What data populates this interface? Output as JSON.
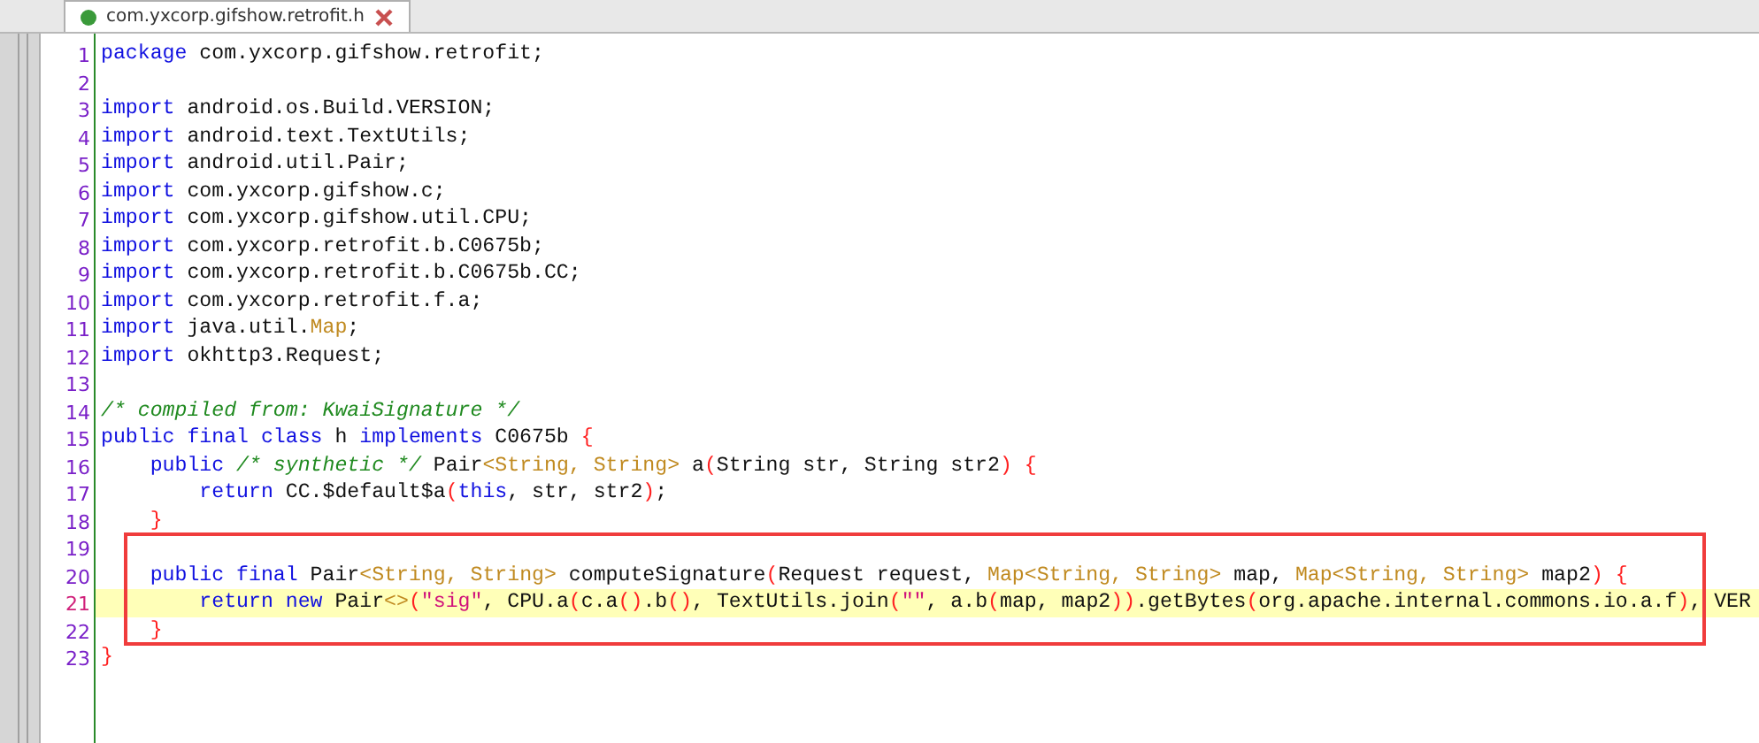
{
  "tab": {
    "title": "com.yxcorp.gifshow.retrofit.h",
    "selected": true
  },
  "lines": [
    {
      "number": "1",
      "current": false,
      "boxed": false,
      "tokens": [
        {
          "kind": "keyword",
          "text": "package"
        },
        {
          "kind": "plain",
          "text": " com.yxcorp.gifshow.retrofit;"
        }
      ]
    },
    {
      "number": "2",
      "current": false,
      "boxed": false
    },
    {
      "number": "3",
      "current": false,
      "boxed": false,
      "tokens": [
        {
          "kind": "keyword",
          "text": "import"
        },
        {
          "kind": "plain",
          "text": " android.os.Build.VERSION;"
        }
      ]
    },
    {
      "number": "4",
      "current": false,
      "boxed": false,
      "tokens": [
        {
          "kind": "keyword",
          "text": "import"
        },
        {
          "kind": "plain",
          "text": " android.text.TextUtils;"
        }
      ]
    },
    {
      "number": "5",
      "current": false,
      "boxed": false,
      "tokens": [
        {
          "kind": "keyword",
          "text": "import"
        },
        {
          "kind": "plain",
          "text": " android.util.Pair;"
        }
      ]
    },
    {
      "number": "6",
      "current": false,
      "boxed": false,
      "tokens": [
        {
          "kind": "keyword",
          "text": "import"
        },
        {
          "kind": "plain",
          "text": " com.yxcorp.gifshow.c;"
        }
      ]
    },
    {
      "number": "7",
      "current": false,
      "boxed": false,
      "tokens": [
        {
          "kind": "keyword",
          "text": "import"
        },
        {
          "kind": "plain",
          "text": " com.yxcorp.gifshow.util.CPU;"
        }
      ]
    },
    {
      "number": "8",
      "current": false,
      "boxed": false,
      "tokens": [
        {
          "kind": "keyword",
          "text": "import"
        },
        {
          "kind": "plain",
          "text": " com.yxcorp.retrofit.b.C0675b;"
        }
      ]
    },
    {
      "number": "9",
      "current": false,
      "boxed": false,
      "tokens": [
        {
          "kind": "keyword",
          "text": "import"
        },
        {
          "kind": "plain",
          "text": " com.yxcorp.retrofit.b.C0675b.CC;"
        }
      ]
    },
    {
      "number": "10",
      "current": false,
      "boxed": false,
      "tokens": [
        {
          "kind": "keyword",
          "text": "import"
        },
        {
          "kind": "plain",
          "text": " com.yxcorp.retrofit.f.a;"
        }
      ]
    },
    {
      "number": "11",
      "current": false,
      "boxed": false,
      "tokens": [
        {
          "kind": "keyword",
          "text": "import"
        },
        {
          "kind": "plain",
          "text": " java.util."
        },
        {
          "kind": "type",
          "text": "Map"
        },
        {
          "kind": "plain",
          "text": ";"
        }
      ]
    },
    {
      "number": "12",
      "current": false,
      "boxed": false,
      "tokens": [
        {
          "kind": "keyword",
          "text": "import"
        },
        {
          "kind": "plain",
          "text": " okhttp3.Request;"
        }
      ]
    },
    {
      "number": "13",
      "current": false,
      "boxed": false
    },
    {
      "number": "14",
      "current": false,
      "boxed": false,
      "tokens": [
        {
          "kind": "comment",
          "text": "/* compiled from: KwaiSignature */"
        }
      ]
    },
    {
      "number": "15",
      "current": false,
      "boxed": false,
      "tokens": [
        {
          "kind": "keyword",
          "text": "public final class"
        },
        {
          "kind": "plain",
          "text": " h "
        },
        {
          "kind": "keyword",
          "text": "implements"
        },
        {
          "kind": "plain",
          "text": " C0675b "
        },
        {
          "kind": "bracket",
          "text": "{"
        }
      ]
    },
    {
      "number": "16",
      "current": false,
      "boxed": false,
      "tokens": [
        {
          "kind": "keyword",
          "text": "    public"
        },
        {
          "kind": "comment",
          "text": " /* synthetic */ "
        },
        {
          "kind": "plain",
          "text": "Pair"
        },
        {
          "kind": "type",
          "text": "<String, String>"
        },
        {
          "kind": "plain",
          "text": " a"
        },
        {
          "kind": "bracket",
          "text": "("
        },
        {
          "kind": "plain",
          "text": "String str, String str2"
        },
        {
          "kind": "bracket",
          "text": ")"
        },
        {
          "kind": "bracket",
          "text": " {"
        }
      ]
    },
    {
      "number": "17",
      "current": false,
      "boxed": false,
      "tokens": [
        {
          "kind": "keyword",
          "text": "        return"
        },
        {
          "kind": "plain",
          "text": " CC.$default$a"
        },
        {
          "kind": "bracket",
          "text": "("
        },
        {
          "kind": "keyword",
          "text": "this"
        },
        {
          "kind": "plain",
          "text": ", str, str2"
        },
        {
          "kind": "bracket",
          "text": ")"
        },
        {
          "kind": "plain",
          "text": ";"
        }
      ]
    },
    {
      "number": "18",
      "current": false,
      "boxed": false,
      "tokens": [
        {
          "kind": "bracket",
          "text": "    }"
        }
      ]
    },
    {
      "number": "19",
      "current": false,
      "boxed": true
    },
    {
      "number": "20",
      "current": false,
      "boxed": true,
      "tokens": [
        {
          "kind": "keyword",
          "text": "    public final"
        },
        {
          "kind": "plain",
          "text": " Pair"
        },
        {
          "kind": "type",
          "text": "<String, String>"
        },
        {
          "kind": "plain",
          "text": " computeSignature"
        },
        {
          "kind": "bracket",
          "text": "("
        },
        {
          "kind": "plain",
          "text": "Request request, "
        },
        {
          "kind": "type",
          "text": "Map<String, String>"
        },
        {
          "kind": "plain",
          "text": " map, "
        },
        {
          "kind": "type",
          "text": "Map<String, String>"
        },
        {
          "kind": "plain",
          "text": " map2"
        },
        {
          "kind": "bracket",
          "text": ")"
        },
        {
          "kind": "bracket",
          "text": " {"
        }
      ]
    },
    {
      "number": "21",
      "current": true,
      "boxed": true,
      "tokens": [
        {
          "kind": "keyword",
          "text": "        return new"
        },
        {
          "kind": "plain",
          "text": " Pair"
        },
        {
          "kind": "type",
          "text": "<>"
        },
        {
          "kind": "bracket",
          "text": "("
        },
        {
          "kind": "string",
          "text": "\"sig\""
        },
        {
          "kind": "plain",
          "text": ", CPU.a"
        },
        {
          "kind": "bracket",
          "text": "("
        },
        {
          "kind": "plain",
          "text": "c.a"
        },
        {
          "kind": "bracket",
          "text": "()"
        },
        {
          "kind": "plain",
          "text": ".b"
        },
        {
          "kind": "bracket",
          "text": "()"
        },
        {
          "kind": "plain",
          "text": ", TextUtils.join"
        },
        {
          "kind": "bracket",
          "text": "("
        },
        {
          "kind": "string",
          "text": "\"\""
        },
        {
          "kind": "plain",
          "text": ", a.b"
        },
        {
          "kind": "bracket",
          "text": "("
        },
        {
          "kind": "plain",
          "text": "map, map2"
        },
        {
          "kind": "bracket",
          "text": "))"
        },
        {
          "kind": "plain",
          "text": ".getBytes"
        },
        {
          "kind": "bracket",
          "text": "("
        },
        {
          "kind": "plain",
          "text": "org.apache.internal.commons.io.a.f"
        },
        {
          "kind": "bracket",
          "text": ")"
        },
        {
          "kind": "plain",
          "text": ", VER"
        }
      ]
    },
    {
      "number": "22",
      "current": false,
      "boxed": true,
      "tokens": [
        {
          "kind": "bracket",
          "text": "    }"
        }
      ]
    },
    {
      "number": "23",
      "current": false,
      "boxed": false,
      "tokens": [
        {
          "kind": "bracket",
          "text": "}"
        }
      ]
    }
  ]
}
